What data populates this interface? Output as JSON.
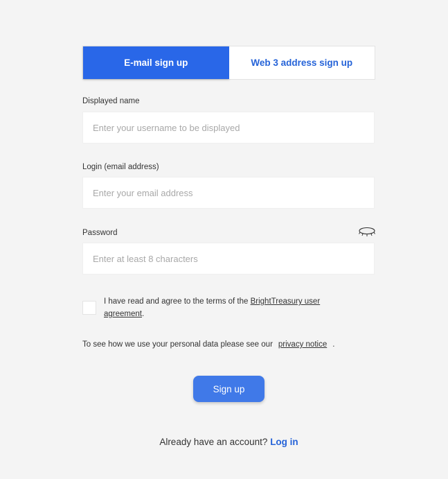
{
  "tabs": [
    {
      "label": "E-mail sign up",
      "active": true
    },
    {
      "label": "Web 3 address sign up",
      "active": false
    }
  ],
  "form": {
    "displayed_name": {
      "label": "Displayed name",
      "value": "",
      "placeholder": "Enter your username to be displayed"
    },
    "email": {
      "label": "Login (email address)",
      "value": "",
      "placeholder": "Enter your email address"
    },
    "password": {
      "label": "Password",
      "value": "",
      "placeholder": "Enter at least 8 characters",
      "toggle_icon": "eye-closed-icon"
    },
    "agreement": {
      "checked": false,
      "text_before": "I have read and agree to the terms of the ",
      "link_text": "BrightTreasury user agreement",
      "text_after": "."
    },
    "privacy": {
      "text_before": "To see how we use your personal data please see our",
      "link_text": "privacy notice",
      "text_after": "."
    },
    "submit_label": "Sign up"
  },
  "footer": {
    "prompt": "Already have an account?",
    "login_label": "Log in"
  },
  "colors": {
    "accent": "#2967e8",
    "button": "#4079e8",
    "link": "#2563d8",
    "background": "#f4f4f4"
  }
}
